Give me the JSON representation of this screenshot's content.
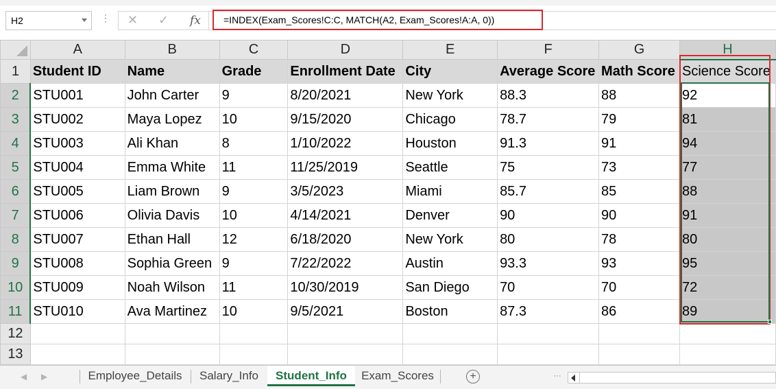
{
  "formula_bar": {
    "name_box": "H2",
    "cancel_glyph": "✕",
    "enter_glyph": "✓",
    "fx_label": "fx",
    "formula": "=INDEX(Exam_Scores!C:C, MATCH(A2, Exam_Scores!A:A, 0))"
  },
  "grid": {
    "columns": [
      "A",
      "B",
      "C",
      "D",
      "E",
      "F",
      "G",
      "H"
    ],
    "row_numbers": [
      "1",
      "2",
      "3",
      "4",
      "5",
      "6",
      "7",
      "8",
      "9",
      "10",
      "11",
      "12",
      "13"
    ],
    "headers": [
      "Student ID",
      "Name",
      "Grade",
      "Enrollment Date",
      "City",
      "Average Score",
      "Math Score",
      "Science Score"
    ],
    "rows": [
      [
        "STU001",
        "John Carter",
        "9",
        "8/20/2021",
        "New York",
        "88.3",
        "88",
        "92"
      ],
      [
        "STU002",
        "Maya Lopez",
        "10",
        "9/15/2020",
        "Chicago",
        "78.7",
        "79",
        "81"
      ],
      [
        "STU003",
        "Ali Khan",
        "8",
        "1/10/2022",
        "Houston",
        "91.3",
        "91",
        "94"
      ],
      [
        "STU004",
        "Emma White",
        "11",
        "11/25/2019",
        "Seattle",
        "75",
        "73",
        "77"
      ],
      [
        "STU005",
        "Liam Brown",
        "9",
        "3/5/2023",
        "Miami",
        "85.7",
        "85",
        "88"
      ],
      [
        "STU006",
        "Olivia Davis",
        "10",
        "4/14/2021",
        "Denver",
        "90",
        "90",
        "91"
      ],
      [
        "STU007",
        "Ethan Hall",
        "12",
        "6/18/2020",
        "New York",
        "80",
        "78",
        "80"
      ],
      [
        "STU008",
        "Sophia Green",
        "9",
        "7/22/2022",
        "Austin",
        "93.3",
        "93",
        "95"
      ],
      [
        "STU009",
        "Noah Wilson",
        "11",
        "10/30/2019",
        "San Diego",
        "70",
        "70",
        "72"
      ],
      [
        "STU010",
        "Ava Martinez",
        "10",
        "9/5/2021",
        "Boston",
        "87.3",
        "86",
        "89"
      ]
    ]
  },
  "sheet_tabs": {
    "nav_prev": "◀",
    "nav_next": "▶",
    "tabs": [
      "Employee_Details",
      "Salary_Info",
      "Student_Info",
      "Exam_Scores"
    ],
    "active_tab": "Student_Info",
    "add_sheet": "+"
  },
  "colors": {
    "excel_green": "#217346",
    "highlight_red": "#d9282e",
    "selection_fill": "#c8c8c8"
  }
}
